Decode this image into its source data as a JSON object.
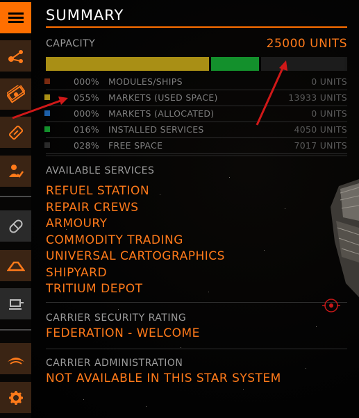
{
  "sidebar": {
    "items": [
      {
        "name": "menu-icon",
        "active": true
      },
      {
        "name": "network-icon"
      },
      {
        "name": "cash-icon"
      },
      {
        "name": "tag-icon"
      },
      {
        "name": "person-check-icon"
      },
      {
        "name": "pill-icon"
      },
      {
        "name": "dome-icon"
      },
      {
        "name": "terminal-icon"
      },
      {
        "name": "carrier-icon"
      },
      {
        "name": "gear-icon"
      }
    ]
  },
  "summary": {
    "title": "SUMMARY",
    "capacity_label": "CAPACITY",
    "capacity_value": "25000 UNITS",
    "bar": {
      "segments": [
        {
          "fraction": 0.55,
          "color": "#a98f15"
        },
        {
          "fraction": 0.16,
          "color": "#13902c"
        },
        {
          "fraction": 0.28,
          "color": "#1c1c1c"
        }
      ]
    },
    "rows": [
      {
        "color": "#7a2a10",
        "pct": "000%",
        "name": "MODULES/SHIPS",
        "units": "0 UNITS"
      },
      {
        "color": "#a98f15",
        "pct": "055%",
        "name": "MARKETS (USED SPACE)",
        "units": "13933 UNITS"
      },
      {
        "color": "#1c5fa8",
        "pct": "000%",
        "name": "MARKETS (ALLOCATED)",
        "units": "0 UNITS"
      },
      {
        "color": "#13902c",
        "pct": "016%",
        "name": "INSTALLED SERVICES",
        "units": "4050 UNITS"
      },
      {
        "color": "#2a2a2a",
        "pct": "028%",
        "name": "FREE SPACE",
        "units": "7017 UNITS"
      }
    ]
  },
  "services": {
    "label": "AVAILABLE SERVICES",
    "items": [
      "REFUEL STATION",
      "REPAIR CREWS",
      "ARMOURY",
      "COMMODITY TRADING",
      "UNIVERSAL CARTOGRAPHICS",
      "SHIPYARD",
      "TRITIUM DEPOT"
    ]
  },
  "security": {
    "label": "CARRIER SECURITY RATING",
    "value": "FEDERATION - WELCOME"
  },
  "administration": {
    "label": "CARRIER ADMINISTRATION",
    "value": "NOT AVAILABLE IN THIS STAR SYSTEM"
  },
  "colors": {
    "accent": "#ff7a1a",
    "muted": "#9c9c9c",
    "annotation_arrow": "#d01818"
  }
}
